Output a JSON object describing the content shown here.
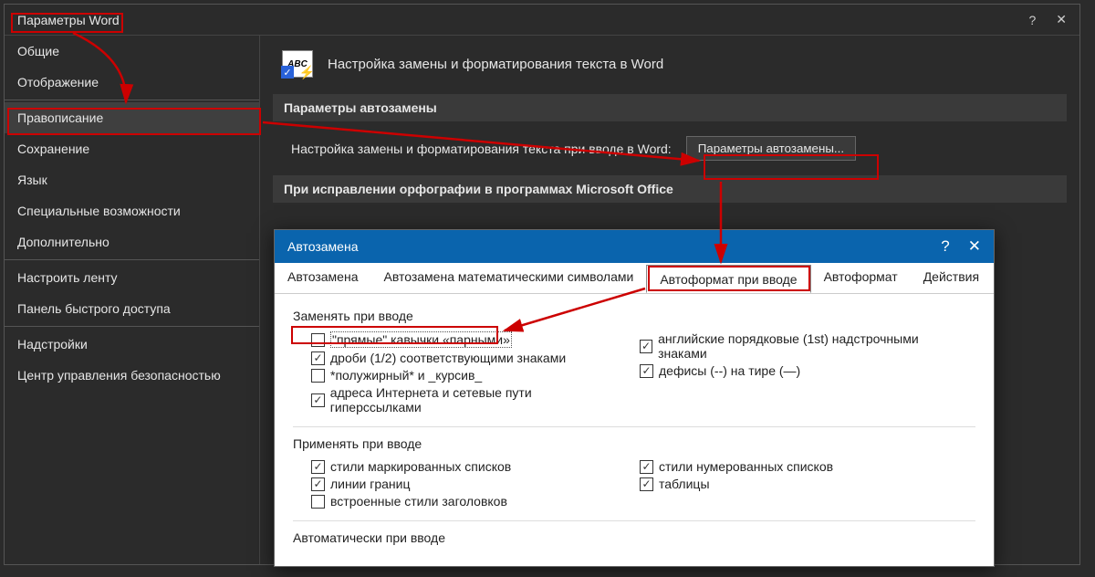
{
  "mainWindow": {
    "title": "Параметры Word",
    "help": "?",
    "close": "✕"
  },
  "sidebar": {
    "items": [
      "Общие",
      "Отображение",
      "Правописание",
      "Сохранение",
      "Язык",
      "Специальные возможности",
      "Дополнительно",
      "Настроить ленту",
      "Панель быстрого доступа",
      "Надстройки",
      "Центр управления безопасностью"
    ],
    "selectedIndex": 2,
    "separatorsAfter": [
      1,
      6,
      8
    ]
  },
  "content": {
    "abcLabel": "ABC",
    "heading": "Настройка замены и форматирования текста в Word",
    "section1": "Параметры автозамены",
    "row1Label": "Настройка замены и форматирования текста при вводе в Word:",
    "row1Button": "Параметры автозамены...",
    "section2": "При исправлении орфографии в программах Microsoft Office"
  },
  "subDialog": {
    "title": "Автозамена",
    "help": "?",
    "close": "✕",
    "tabs": [
      "Автозамена",
      "Автозамена математическими символами",
      "Автоформат при вводе",
      "Автоформат",
      "Действия"
    ],
    "activeTab": 2,
    "group1": {
      "label": "Заменять при вводе",
      "left": [
        {
          "txt": "\"прямые\" кавычки «парными»",
          "on": false,
          "focus": true
        },
        {
          "txt": "дроби (1/2) соответствующими знаками",
          "on": true
        },
        {
          "txt": "*полужирный* и _курсив_",
          "on": false
        },
        {
          "txt": "адреса Интернета и сетевые пути гиперссылками",
          "on": true
        }
      ],
      "right": [
        {
          "txt": "английские порядковые (1st) надстрочными знаками",
          "on": true
        },
        {
          "txt": "дефисы (--) на тире (—)",
          "on": true
        }
      ]
    },
    "group2": {
      "label": "Применять при вводе",
      "left": [
        {
          "txt": "стили маркированных списков",
          "on": true
        },
        {
          "txt": "линии границ",
          "on": true
        },
        {
          "txt": "встроенные стили заголовков",
          "on": false
        }
      ],
      "right": [
        {
          "txt": "стили нумерованных списков",
          "on": true
        },
        {
          "txt": "таблицы",
          "on": true
        }
      ]
    },
    "group3": {
      "label": "Автоматически при вводе"
    }
  }
}
